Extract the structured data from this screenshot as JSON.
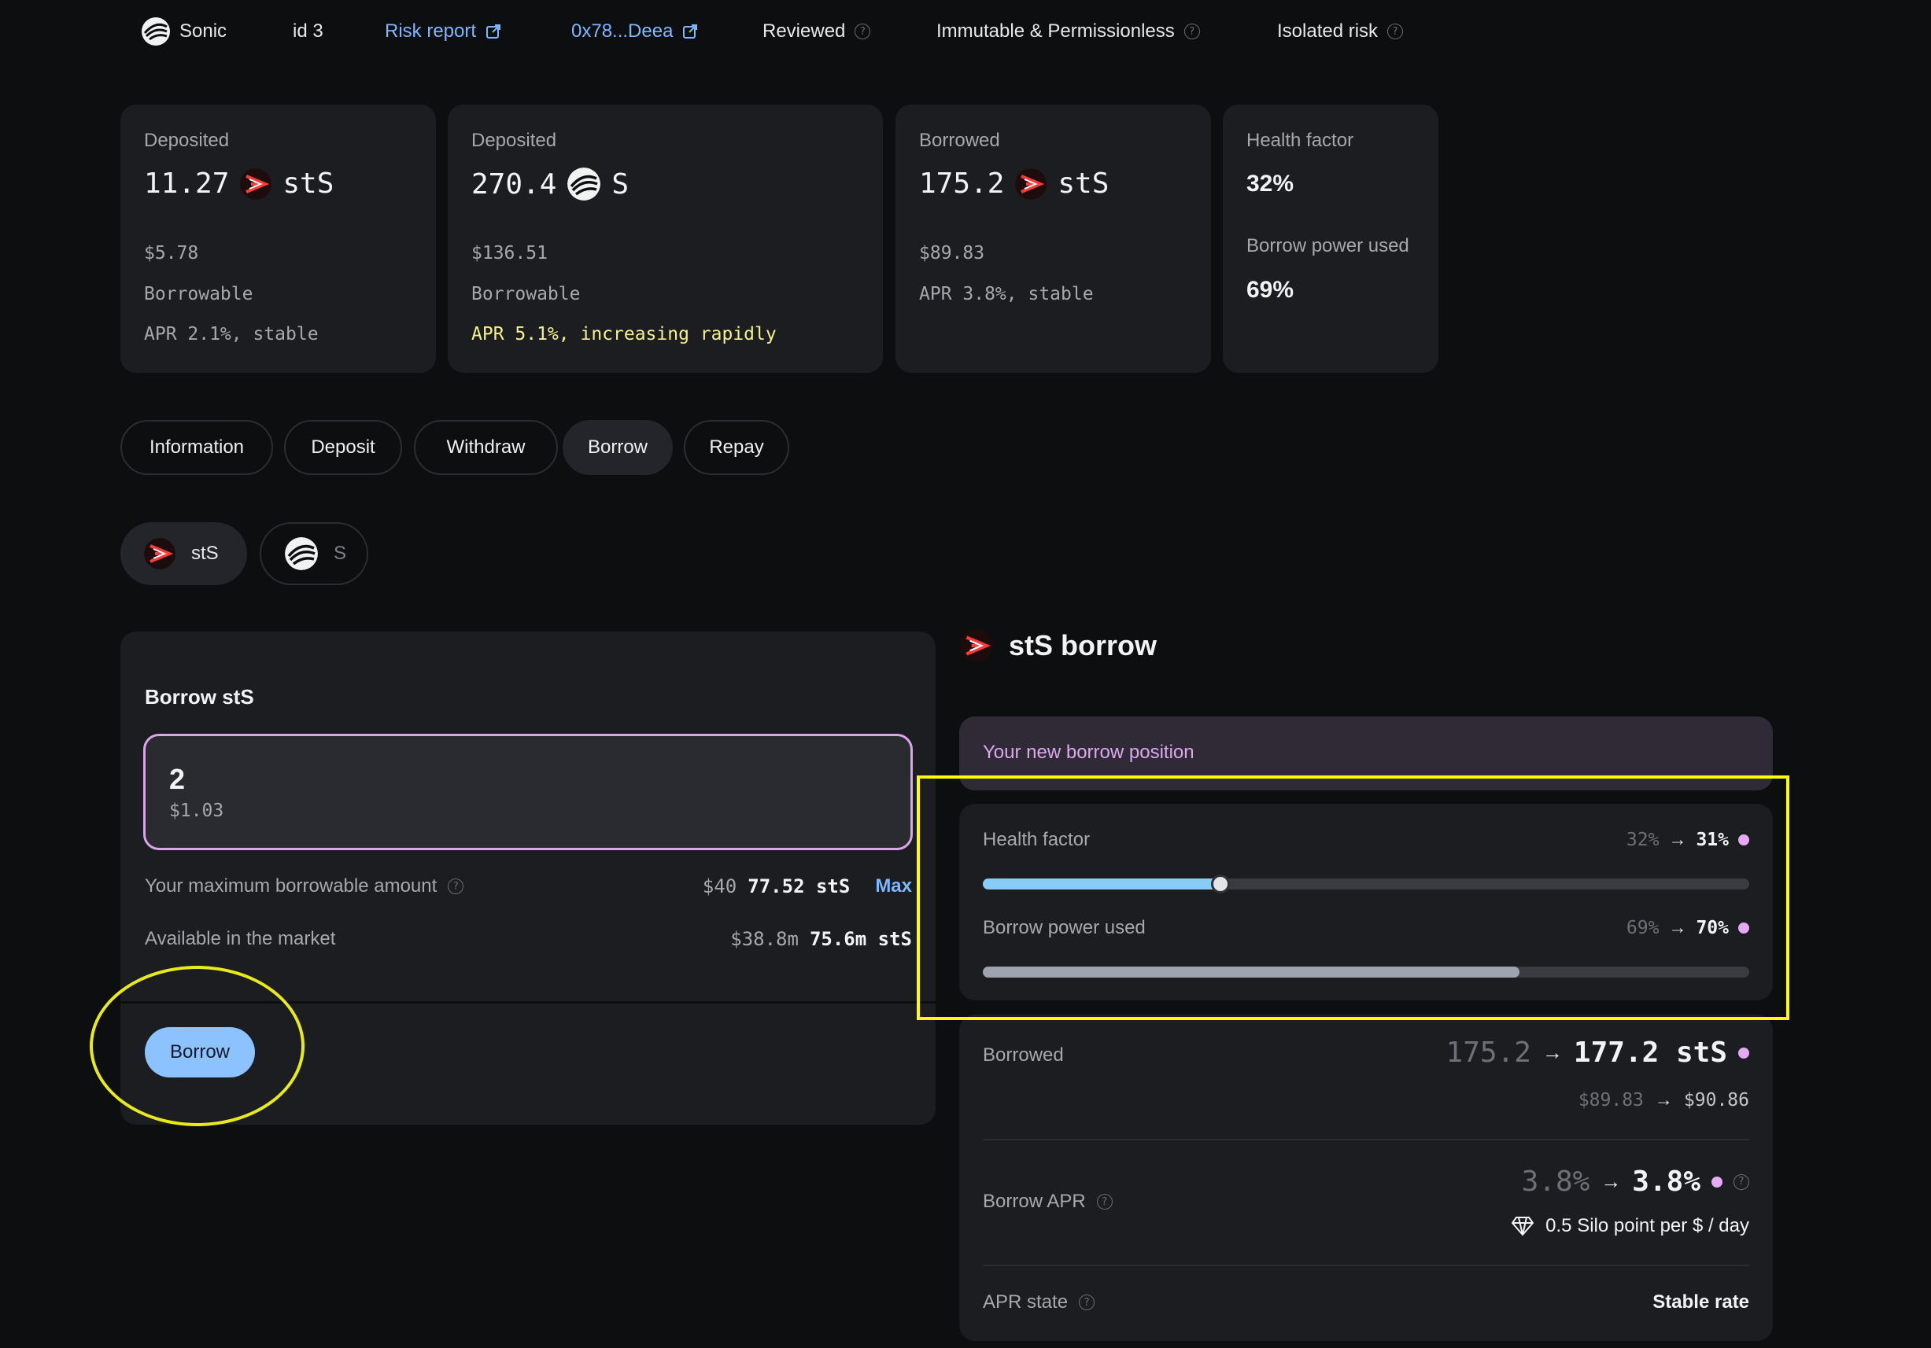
{
  "topbar": {
    "network": "Sonic",
    "market_id": "id 3",
    "risk_report": "Risk report",
    "address": "0x78...Deea",
    "reviewed": "Reviewed",
    "immutable": "Immutable & Permissionless",
    "isolated": "Isolated risk"
  },
  "cards": {
    "deposited_sts": {
      "label": "Deposited",
      "amount": "11.27",
      "token": "stS",
      "usd": "$5.78",
      "status": "Borrowable",
      "apr": "APR 2.1%, stable"
    },
    "deposited_s": {
      "label": "Deposited",
      "amount": "270.4",
      "token": "S",
      "usd": "$136.51",
      "status": "Borrowable",
      "apr": "APR 5.1%, increasing rapidly"
    },
    "borrowed": {
      "label": "Borrowed",
      "amount": "175.2",
      "token": "stS",
      "usd": "$89.83",
      "apr": "APR 3.8%, stable"
    },
    "health": {
      "label": "Health factor",
      "value": "32%",
      "power_label": "Borrow power used",
      "power_value": "69%"
    }
  },
  "tabs": [
    "Information",
    "Deposit",
    "Withdraw",
    "Borrow",
    "Repay"
  ],
  "assets": [
    "stS",
    "S"
  ],
  "form": {
    "title": "Borrow stS",
    "input_value": "2",
    "input_usd": "$1.03",
    "max_label": "Your maximum borrowable amount",
    "max_usd": "$40",
    "max_amount": "77.52 stS",
    "max_link": "Max",
    "avail_label": "Available in the market",
    "avail_usd": "$38.8m",
    "avail_amount": "75.6m stS",
    "button": "Borrow"
  },
  "position": {
    "title": "stS borrow",
    "header": "Your new borrow position",
    "health_label": "Health factor",
    "health_from": "32%",
    "health_to": "31%",
    "health_fill": 0.31,
    "power_label": "Borrow power used",
    "power_from": "69%",
    "power_to": "70%",
    "power_fill": 0.7,
    "borrowed_label": "Borrowed",
    "borrowed_from": "175.2",
    "borrowed_to": "177.2 stS",
    "borrowed_usd_from": "$89.83",
    "borrowed_usd_to": "$90.86",
    "apr_label": "Borrow APR",
    "apr_from": "3.8%",
    "apr_to": "3.8%",
    "points": "0.5 Silo point per $ / day",
    "state_label": "APR state",
    "state_value": "Stable rate"
  },
  "colors": {
    "accent_blue": "#8cc2ff",
    "link": "#7cb7ff",
    "pink": "#e6a9f5",
    "warn": "#f5f08a",
    "annotation": "#ffff00"
  }
}
